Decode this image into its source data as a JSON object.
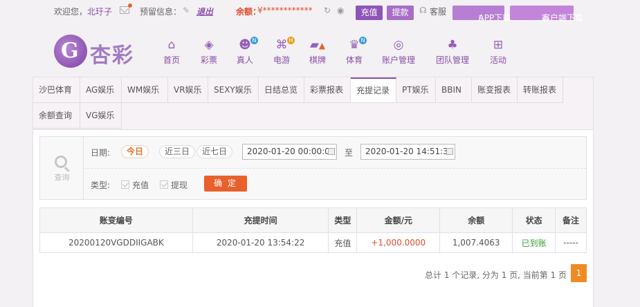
{
  "topbar": {
    "welcome": "欢迎您，",
    "username": "北玗子",
    "reserve_label": "预留信息：",
    "logout": "退出",
    "balance_label": "余额：",
    "balance_value": "¥************",
    "deposit": "充值",
    "withdraw": "提款",
    "service": "客服",
    "app_download": "APP下载",
    "client_download": "客户端下载"
  },
  "logo": {
    "text": "杏彩"
  },
  "nav": [
    {
      "label": "首页",
      "icon": "home-icon"
    },
    {
      "label": "彩票",
      "icon": "lottery-icon"
    },
    {
      "label": "真人",
      "icon": "live-dealer-icon",
      "badge": "N"
    },
    {
      "label": "电游",
      "icon": "gamepad-icon",
      "badge": "H"
    },
    {
      "label": "棋牌",
      "icon": "cards-icon"
    },
    {
      "label": "体育",
      "icon": "trophy-icon",
      "badge": "N"
    },
    {
      "label": "账户管理",
      "icon": "account-icon"
    },
    {
      "label": "团队管理",
      "icon": "team-icon"
    },
    {
      "label": "活动",
      "icon": "gift-icon"
    }
  ],
  "tabs": [
    "沙巴体育",
    "AG娱乐",
    "WM娱乐",
    "VR娱乐",
    "SEXY娱乐",
    "日结总览",
    "彩票报表",
    "充提记录",
    "PT娱乐",
    "BBIN",
    "账变报表",
    "转账报表",
    "余额查询",
    "VG娱乐"
  ],
  "active_tab": "充提记录",
  "filter": {
    "query_label": "查询",
    "date_label": "日期:",
    "day_options": [
      "今日",
      "近三日",
      "近七日"
    ],
    "date_from": "2020-01-20 00:00:00",
    "date_sep": "至",
    "date_to": "2020-01-20 14:51:33",
    "type_label": "类型:",
    "types": [
      "充值",
      "提现"
    ],
    "confirm": "确 定"
  },
  "table": {
    "headers": [
      "账变编号",
      "充提时间",
      "类型",
      "金额/元",
      "余额",
      "状态",
      "备注"
    ],
    "rows": [
      [
        "20200120VGDDIIGABK",
        "2020-01-20 13:54:22",
        "充值",
        "+1,000.0000",
        "1,007.4063",
        "已到账",
        "-----"
      ]
    ]
  },
  "pager": {
    "summary": "总计 1 个记录, 分为 1 页, 当前第 1 页",
    "current": "1"
  },
  "colors": {
    "brand": "#8a4fa8",
    "accent": "#e8612c",
    "success": "#3b9b3b"
  }
}
